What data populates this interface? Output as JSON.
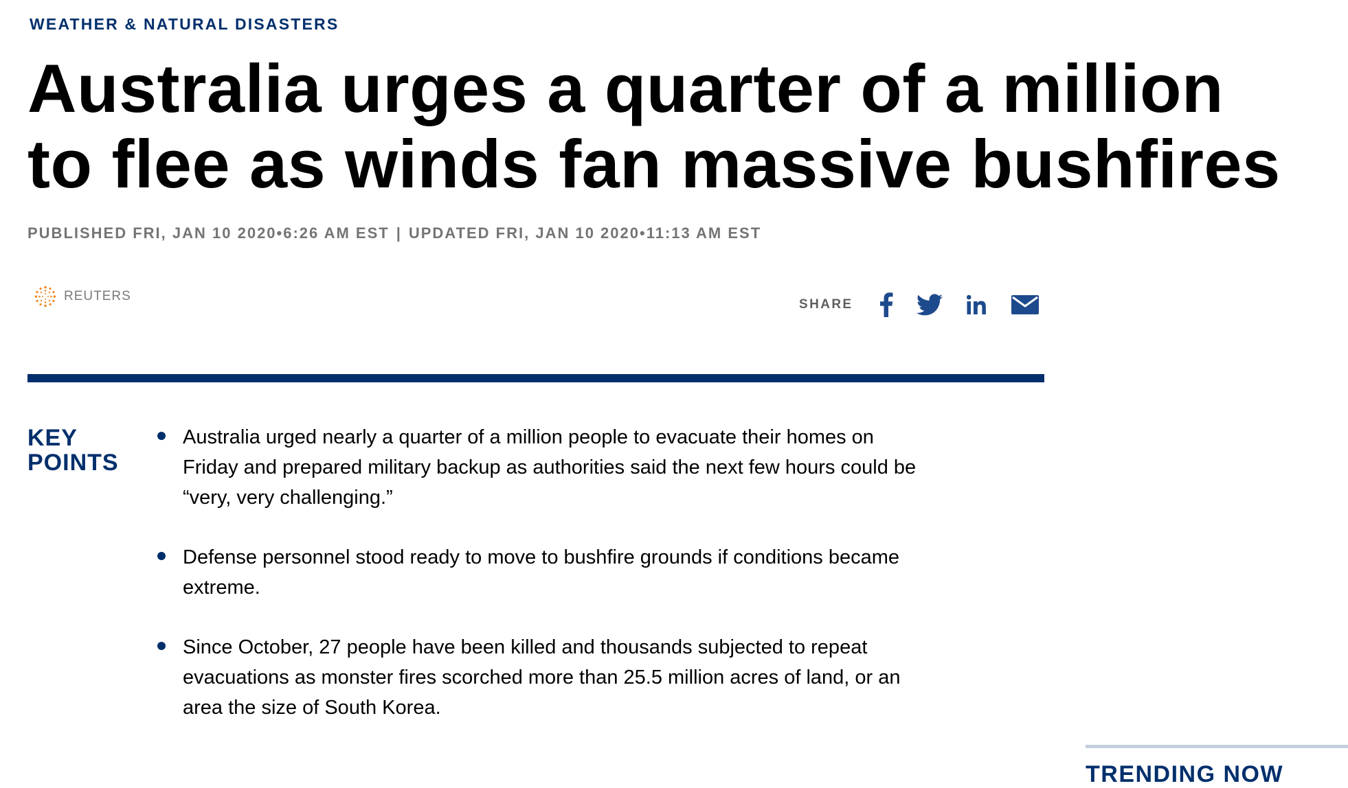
{
  "category": "WEATHER & NATURAL DISASTERS",
  "headline": {
    "line1": "Australia urges a quarter of a million",
    "line2": "to flee as winds fan massive bushfires"
  },
  "dateline": {
    "published": "PUBLISHED FRI, JAN 10 2020•6:26 AM EST",
    "separator": "|",
    "updated": "UPDATED FRI, JAN 10 2020•11:13 AM EST"
  },
  "source": {
    "name": "REUTERS",
    "logo_icon": "reuters-logo-icon"
  },
  "share": {
    "label": "SHARE",
    "buttons": [
      {
        "network": "facebook",
        "icon": "facebook-icon"
      },
      {
        "network": "twitter",
        "icon": "twitter-icon"
      },
      {
        "network": "linkedin",
        "icon": "linkedin-icon"
      },
      {
        "network": "email",
        "icon": "email-icon"
      }
    ]
  },
  "key_points": {
    "title_line1": "KEY",
    "title_line2": "POINTS",
    "items": [
      {
        "lines": [
          "Australia urged nearly a quarter of a million people to evacuate their homes on",
          "Friday and prepared military backup as authorities said the next few hours could be",
          "“very, very challenging.”"
        ]
      },
      {
        "lines": [
          "Defense personnel stood ready to move to bushfire grounds if conditions became",
          "extreme."
        ]
      },
      {
        "lines": [
          "Since October, 27 people have been killed and thousands subjected to repeat",
          "evacuations as monster fires scorched more than 25.5 million acres of land, or an",
          "area the size of South Korea."
        ]
      }
    ]
  },
  "sidebar": {
    "trending_title": "TRENDING NOW"
  },
  "colors": {
    "brand_navy": "#002f6c",
    "meta_gray": "#747474",
    "share_icon": "#1d4a8c",
    "trending_rule": "#c5d0dc"
  }
}
